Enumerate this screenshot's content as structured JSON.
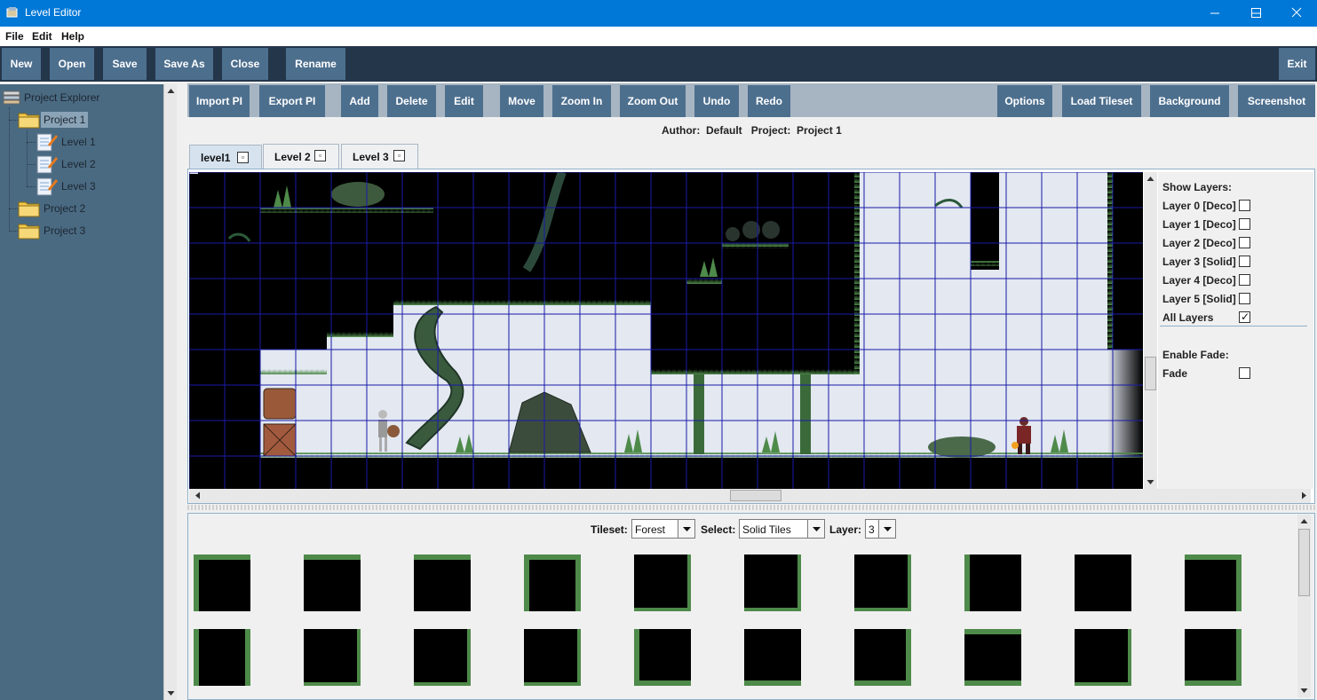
{
  "window": {
    "title": "Level Editor",
    "controls": [
      "minimize-icon",
      "maximize-icon",
      "close-icon"
    ]
  },
  "menu": [
    "File",
    "Edit",
    "Help"
  ],
  "main_toolbar": {
    "left": [
      "New",
      "Open",
      "Save",
      "Save As",
      "Close",
      "Rename"
    ],
    "right": [
      "Exit"
    ]
  },
  "project_explorer": {
    "title": "Project Explorer",
    "projects": [
      {
        "label": "Project 1",
        "selected": true,
        "levels": [
          "Level 1",
          "Level 2",
          "Level 3"
        ]
      },
      {
        "label": "Project 2",
        "selected": false,
        "levels": []
      },
      {
        "label": "Project 3",
        "selected": false,
        "levels": []
      }
    ]
  },
  "editor_toolbar": {
    "left": [
      "Import PI",
      "Export PI",
      "Add",
      "Delete",
      "Edit",
      "Move",
      "Zoom In",
      "Zoom Out",
      "Undo",
      "Redo"
    ],
    "right": [
      "Options",
      "Load Tileset",
      "Background",
      "Screenshot"
    ]
  },
  "info": {
    "author_label": "Author:",
    "author": "Default",
    "project_label": "Project:",
    "project": "Project 1"
  },
  "tabs": [
    {
      "label": "level1",
      "active": true
    },
    {
      "label": "Level 2",
      "active": false
    },
    {
      "label": "Level 3",
      "active": false
    }
  ],
  "layers_panel": {
    "show_layers_title": "Show Layers:",
    "layers": [
      {
        "label": "Layer 0 [Deco]",
        "checked": false
      },
      {
        "label": "Layer 1 [Deco]",
        "checked": false
      },
      {
        "label": "Layer 2 [Deco]",
        "checked": false
      },
      {
        "label": "Layer 3 [Solid]",
        "checked": false
      },
      {
        "label": "Layer 4 [Deco]",
        "checked": false
      },
      {
        "label": "Layer 5 [Solid]",
        "checked": false
      },
      {
        "label": "All Layers",
        "checked": true
      }
    ],
    "fade_title": "Enable Fade:",
    "fade_label": "Fade",
    "fade_checked": false
  },
  "palette": {
    "tileset_label": "Tileset:",
    "tileset_value": "Forest",
    "select_label": "Select:",
    "select_value": "Solid Tiles",
    "layer_label": "Layer:",
    "layer_value": "3"
  },
  "colors": {
    "titlebar": "#0078d7",
    "main_toolbar_bg": "#24364a",
    "button": "#4d6f8e",
    "explorer_bg": "#4a6a82",
    "grid": "#1a1aa8",
    "grass": "#4e8a4a"
  }
}
